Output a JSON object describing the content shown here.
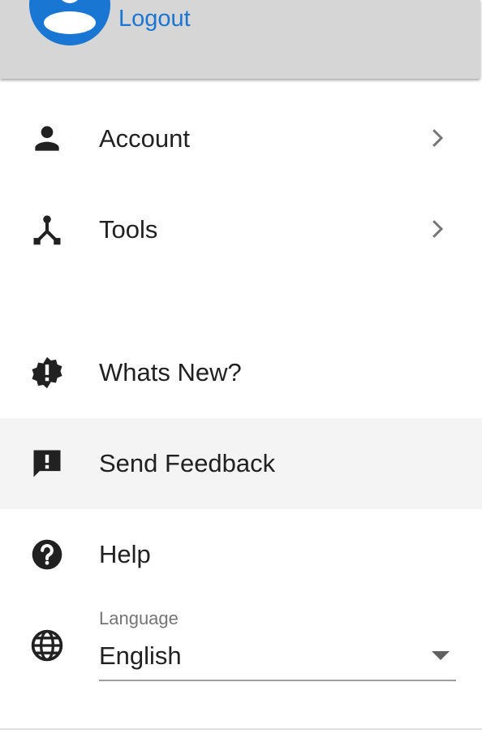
{
  "header": {
    "logout_label": "Logout",
    "background_color": "#d6d6d6",
    "accent_color": "#1976d2"
  },
  "menu": {
    "primary": [
      {
        "label": "Account",
        "icon": "person-icon",
        "has_submenu": true
      },
      {
        "label": "Tools",
        "icon": "tools-icon",
        "has_submenu": true
      }
    ],
    "secondary": [
      {
        "label": "Whats New?",
        "icon": "new-releases-icon",
        "selected": false
      },
      {
        "label": "Send Feedback",
        "icon": "feedback-icon",
        "selected": true
      },
      {
        "label": "Help",
        "icon": "help-icon",
        "selected": false
      }
    ]
  },
  "language": {
    "caption": "Language",
    "selected": "English",
    "icon": "globe-icon"
  }
}
